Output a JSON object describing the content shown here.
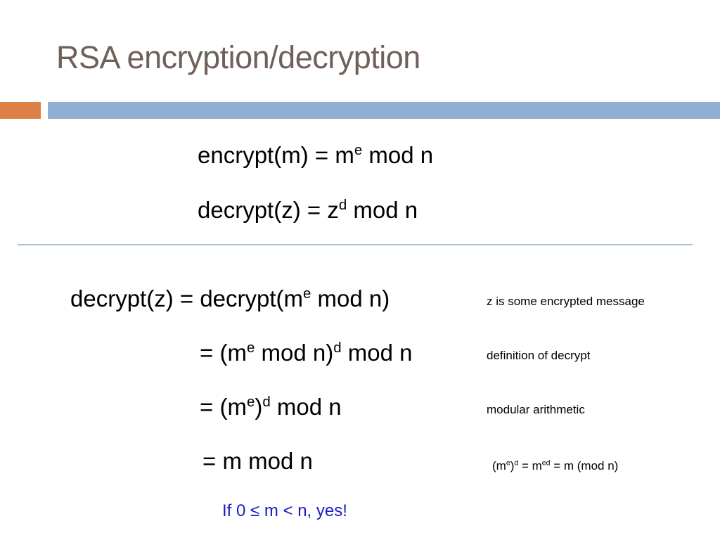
{
  "slide": {
    "title": "RSA encryption/decryption",
    "colors": {
      "title": "#70605A",
      "accent_orange": "#DD8046",
      "accent_blue": "#8FB0D3",
      "divider": "#A8C0D6",
      "body_text": "#000000",
      "conclusion_text": "#1A1AC8"
    }
  },
  "definitions": [
    {
      "id": "encrypt",
      "lhs": "encrypt(m)",
      "eq": "=",
      "base": "m",
      "exponent": "e",
      "tail": "mod n",
      "plain": "encrypt(m) = m^e mod n"
    },
    {
      "id": "decrypt",
      "lhs": "decrypt(z)",
      "eq": "=",
      "base": "z",
      "exponent": "d",
      "tail": "mod n",
      "plain": "decrypt(z) = z^d mod n"
    }
  ],
  "derivation": [
    {
      "lhs": "decrypt(z) =",
      "rhs_pre": "decrypt(m",
      "rhs_sup": "e",
      "rhs_post": " mod n)",
      "plain": "decrypt(z) = decrypt(m^e mod n)",
      "annotation": "z is some encrypted message"
    },
    {
      "lhs": "=",
      "rhs_pre": " (m",
      "rhs_sup": "e",
      "rhs_post": " mod n)",
      "rhs_sup2": "d",
      "rhs_post2": " mod n",
      "plain": "= (m^e mod n)^d mod n",
      "annotation": "definition of decrypt"
    },
    {
      "lhs": "=",
      "rhs_pre": " (m",
      "rhs_sup": "e",
      "rhs_post": ")",
      "rhs_sup2": "d",
      "rhs_post2": " mod n",
      "plain": "= (m^e)^d mod n",
      "annotation": "modular arithmetic"
    },
    {
      "lhs": "=",
      "rhs_pre": " m mod n",
      "plain": "= m mod n",
      "annotation": "(m^e)^d = m^ed = m (mod n)"
    }
  ],
  "annotation_math": {
    "part1_base": "(m",
    "part1_sup": "e",
    "part1_close": ")",
    "part1_sup2": "d",
    "eq1": " = m",
    "sup3": "ed",
    "eq2": " = m (mod n)",
    "plain": "(m^e)^d = m^ed = m (mod n)"
  },
  "conclusion": {
    "text": "If 0 ≤ m < n, yes!"
  }
}
